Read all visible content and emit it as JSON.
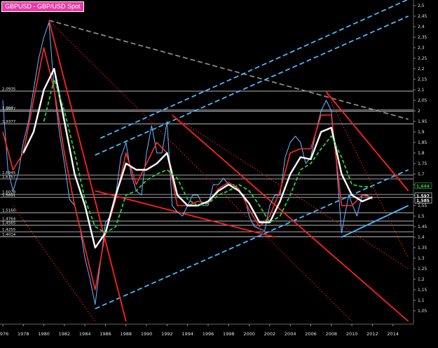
{
  "chart_data": {
    "type": "line",
    "title": "GBPUSD - GBP/USD Spot",
    "xlim": [
      1976,
      2016
    ],
    "ylim": [
      1.0,
      2.5
    ],
    "x_ticks": [
      "1976",
      "1978",
      "1980",
      "1982",
      "1984",
      "1986",
      "1988",
      "1990",
      "1992",
      "1994",
      "1996",
      "1998",
      "2000",
      "2002",
      "2004",
      "2006",
      "2008",
      "2010",
      "2012",
      "2014"
    ],
    "y_ticks": [
      "2,5",
      "2,45",
      "2,4",
      "2,35",
      "2,3",
      "2,25",
      "2,2",
      "2,15",
      "2,1",
      "2,05",
      "2",
      "1,95",
      "1,9",
      "1,85",
      "1,8",
      "1,75",
      "1,7",
      "1,65",
      "1,6",
      "1,55",
      "1,5",
      "1,45",
      "1,4",
      "1,35",
      "1,3",
      "1,25",
      "1,2",
      "1,15",
      "1,1",
      "1,05"
    ],
    "horizontal_levels": [
      {
        "label": "2,0935",
        "value": 2.0935
      },
      {
        "label": "2,004",
        "value": 2.004
      },
      {
        "label": "1,9977",
        "value": 1.9977
      },
      {
        "label": "1,9377",
        "value": 1.9377
      },
      {
        "label": "1,6945",
        "value": 1.6945
      },
      {
        "label": "1,6767",
        "value": 1.6767
      },
      {
        "label": "1,6028",
        "value": 1.6028
      },
      {
        "label": "1,5891",
        "value": 1.5891
      },
      {
        "label": "1,5160",
        "value": 1.516
      },
      {
        "label": "1,4764",
        "value": 1.4764
      },
      {
        "label": "1,4565",
        "value": 1.4565
      },
      {
        "label": "1,4255",
        "value": 1.4255
      },
      {
        "label": "1,4014",
        "value": 1.4014
      }
    ],
    "price_badges": [
      {
        "label": "1,644",
        "value": 1.644,
        "color": "#2ecc40"
      },
      {
        "label": "1,597",
        "value": 1.597,
        "color": "#ffffff"
      },
      {
        "label": "1,585",
        "value": 1.585,
        "color": "#ffffff"
      }
    ],
    "series": [
      {
        "color": "#6fb6ff",
        "x": [
          1976,
          1976.5,
          1977,
          1977.5,
          1978,
          1978.5,
          1979,
          1979.5,
          1980,
          1980.5,
          1981,
          1981.5,
          1982,
          1982.5,
          1983,
          1983.5,
          1984,
          1984.5,
          1985,
          1985.3,
          1985.7,
          1986,
          1986.5,
          1987,
          1987.5,
          1988,
          1988.5,
          1989,
          1989.5,
          1990,
          1990.5,
          1991,
          1991.5,
          1992,
          1992.5,
          1993,
          1993.5,
          1994,
          1994.5,
          1995,
          1995.5,
          1996,
          1996.5,
          1997,
          1997.5,
          1998,
          1998.5,
          1999,
          1999.5,
          2000,
          2000.5,
          2001,
          2001.5,
          2002,
          2002.5,
          2003,
          2003.5,
          2004,
          2004.5,
          2005,
          2005.5,
          2006,
          2006.5,
          2007,
          2007.5,
          2008,
          2008.5,
          2009,
          2009.3,
          2009.7,
          2010,
          2010.5,
          2011,
          2011.5,
          2012
        ],
        "y": [
          2.05,
          1.72,
          1.62,
          1.7,
          1.85,
          1.95,
          2.1,
          2.25,
          2.35,
          2.42,
          2.1,
          1.9,
          1.75,
          1.58,
          1.55,
          1.45,
          1.3,
          1.2,
          1.08,
          1.2,
          1.35,
          1.47,
          1.5,
          1.6,
          1.78,
          1.85,
          1.7,
          1.62,
          1.6,
          1.8,
          1.93,
          1.8,
          1.8,
          1.95,
          1.55,
          1.52,
          1.5,
          1.55,
          1.6,
          1.6,
          1.55,
          1.55,
          1.65,
          1.65,
          1.68,
          1.65,
          1.65,
          1.62,
          1.6,
          1.5,
          1.45,
          1.44,
          1.43,
          1.55,
          1.6,
          1.6,
          1.78,
          1.85,
          1.88,
          1.85,
          1.75,
          1.78,
          1.9,
          2.0,
          2.05,
          2.0,
          1.75,
          1.42,
          1.5,
          1.6,
          1.56,
          1.5,
          1.6,
          1.6,
          1.58
        ]
      },
      {
        "color": "#ff2a2a",
        "x": [
          1976,
          1977,
          1978,
          1979,
          1980,
          1981,
          1982,
          1983,
          1984,
          1985,
          1986,
          1987,
          1988,
          1989,
          1990,
          1991,
          1992,
          1993,
          1994,
          1995,
          1996,
          1997,
          1998,
          1999,
          2000,
          2001,
          2002,
          2003,
          2004,
          2005,
          2006,
          2007,
          2008,
          2009,
          2010,
          2011,
          2012
        ],
        "y": [
          1.9,
          1.72,
          1.8,
          2.05,
          2.3,
          2.1,
          1.8,
          1.55,
          1.35,
          1.15,
          1.42,
          1.58,
          1.8,
          1.65,
          1.75,
          1.85,
          1.8,
          1.55,
          1.55,
          1.57,
          1.56,
          1.63,
          1.66,
          1.63,
          1.53,
          1.45,
          1.5,
          1.62,
          1.8,
          1.82,
          1.82,
          1.98,
          1.98,
          1.55,
          1.55,
          1.6,
          1.59
        ]
      },
      {
        "color": "#ffffff",
        "x": [
          1978,
          1979,
          1980,
          1981,
          1982,
          1983,
          1984,
          1985,
          1986,
          1987,
          1988,
          1989,
          1990,
          1991,
          1992,
          1993,
          1994,
          1995,
          1996,
          1997,
          1998,
          1999,
          2000,
          2001,
          2002,
          2003,
          2004,
          2005,
          2006,
          2007,
          2008,
          2009,
          2010,
          2011,
          2012
        ],
        "y": [
          1.8,
          1.9,
          2.1,
          2.2,
          1.95,
          1.7,
          1.55,
          1.35,
          1.42,
          1.6,
          1.75,
          1.72,
          1.72,
          1.75,
          1.8,
          1.6,
          1.55,
          1.55,
          1.57,
          1.62,
          1.65,
          1.62,
          1.56,
          1.47,
          1.47,
          1.57,
          1.7,
          1.78,
          1.77,
          1.9,
          1.92,
          1.7,
          1.6,
          1.57,
          1.59
        ]
      },
      {
        "color": "#2ecc40",
        "dashed": true,
        "x": [
          1980,
          1981,
          1982,
          1983,
          1984,
          1985,
          1986,
          1987,
          1988,
          1989,
          1990,
          1991,
          1992,
          1993,
          1994,
          1995,
          1996,
          1997,
          1998,
          1999,
          2000,
          2001,
          2002,
          2003,
          2004,
          2005,
          2006,
          2007,
          2008,
          2009,
          2010,
          2011,
          2012
        ],
        "y": [
          1.95,
          2.15,
          2.0,
          1.8,
          1.58,
          1.45,
          1.42,
          1.45,
          1.6,
          1.62,
          1.67,
          1.7,
          1.72,
          1.68,
          1.58,
          1.55,
          1.56,
          1.6,
          1.62,
          1.65,
          1.62,
          1.55,
          1.47,
          1.5,
          1.6,
          1.72,
          1.75,
          1.82,
          1.88,
          1.78,
          1.65,
          1.64,
          1.64
        ]
      }
    ],
    "trendlines": [
      {
        "color": "#888888",
        "dashed": true,
        "x": [
          1980.5,
          2015.5
        ],
        "y": [
          2.43,
          1.96
        ]
      },
      {
        "color": "#4ab8ff",
        "dashed": true,
        "x": [
          1985.0,
          2015.5
        ],
        "y": [
          1.06,
          1.72
        ]
      },
      {
        "color": "#4ab8ff",
        "dashed": true,
        "x": [
          1985.0,
          2015.5
        ],
        "y": [
          1.79,
          2.45
        ]
      },
      {
        "color": "#4ab8ff",
        "dashed": true,
        "x": [
          1985.5,
          2015.5
        ],
        "y": [
          1.87,
          2.53
        ]
      },
      {
        "color": "#4ab8ff",
        "dashed": false,
        "x": [
          2009.0,
          2015.5
        ],
        "y": [
          1.4,
          1.55
        ]
      },
      {
        "color": "#ff2020",
        "dashed": false,
        "x": [
          1980.5,
          1988.0
        ],
        "y": [
          2.43,
          1.0
        ]
      },
      {
        "color": "#ff2020",
        "dashed": false,
        "x": [
          1992.5,
          2015.5
        ],
        "y": [
          1.98,
          1.0
        ]
      },
      {
        "color": "#ff2020",
        "dashed": false,
        "x": [
          1985.0,
          2002.5
        ],
        "y": [
          1.62,
          1.4
        ]
      },
      {
        "color": "#ff2020",
        "dashed": false,
        "x": [
          2007.5,
          2015.5
        ],
        "y": [
          2.09,
          1.62
        ]
      },
      {
        "color": "#ff2020",
        "dotted": true,
        "x": [
          1980.5,
          2010.0
        ],
        "y": [
          2.43,
          1.0
        ]
      },
      {
        "color": "#ff2020",
        "dotted": true,
        "x": [
          1992.5,
          2015.5
        ],
        "y": [
          1.98,
          1.25
        ]
      },
      {
        "color": "#ff2020",
        "dotted": true,
        "x": [
          1977.0,
          1985.0
        ],
        "y": [
          1.55,
          1.0
        ]
      },
      {
        "color": "#ff2020",
        "dotted": true,
        "x": [
          2007.5,
          2015.5
        ],
        "y": [
          2.09,
          1.3
        ]
      }
    ],
    "grid": false
  }
}
